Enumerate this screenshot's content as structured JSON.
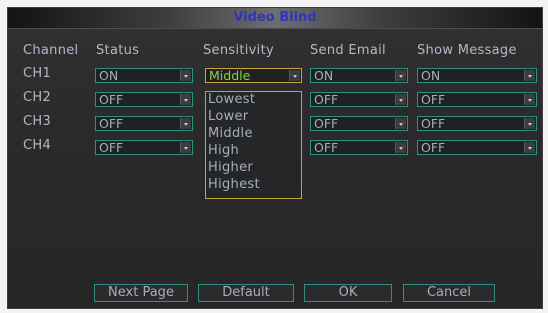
{
  "window": {
    "title": "Video Blind"
  },
  "headers": [
    "Channel",
    "Status",
    "Sensitivity",
    "Send Email",
    "Show Message"
  ],
  "rows": [
    {
      "channel": "CH1",
      "status": "ON",
      "sensitivity": "Middle",
      "send_email": "ON",
      "show_message": "ON"
    },
    {
      "channel": "CH2",
      "status": "OFF",
      "send_email": "OFF",
      "show_message": "OFF"
    },
    {
      "channel": "CH3",
      "status": "OFF",
      "send_email": "OFF",
      "show_message": "OFF"
    },
    {
      "channel": "CH4",
      "status": "OFF",
      "sensitivity": "",
      "send_email": "OFF",
      "show_message": "OFF"
    }
  ],
  "sensitivity_options": [
    "Lowest",
    "Lower",
    "Middle",
    "High",
    "Higher",
    "Highest"
  ],
  "buttons": {
    "next_page": "Next Page",
    "default": "Default",
    "ok": "OK",
    "cancel": "Cancel"
  },
  "colors": {
    "accent_border": "#2f8f82",
    "focus_border": "#c9a33a",
    "selected_text": "#8bd141",
    "title_text": "#2f36b8"
  }
}
